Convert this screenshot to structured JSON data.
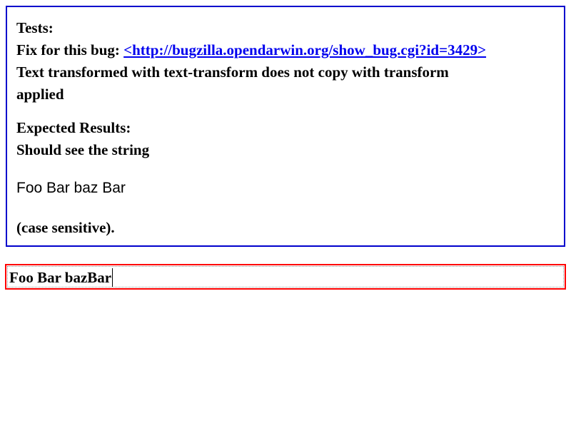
{
  "test_box": {
    "tests_label": "Tests:",
    "fix_prefix": "Fix for this bug: ",
    "bug_link": "<http://bugzilla.opendarwin.org/show_bug.cgi?id=3429>",
    "description_line1": "Text transformed with text-transform does not copy with transform",
    "description_line2": "applied",
    "expected_label": "Expected Results:",
    "expected_text": "Should see the string",
    "sample_string": "Foo Bar baz Bar",
    "case_note": "(case sensitive)."
  },
  "input_field": {
    "value": "Foo Bar bazBar"
  },
  "colors": {
    "test_border": "#0000cc",
    "link": "#0000ee",
    "input_border": "#ff0000"
  }
}
